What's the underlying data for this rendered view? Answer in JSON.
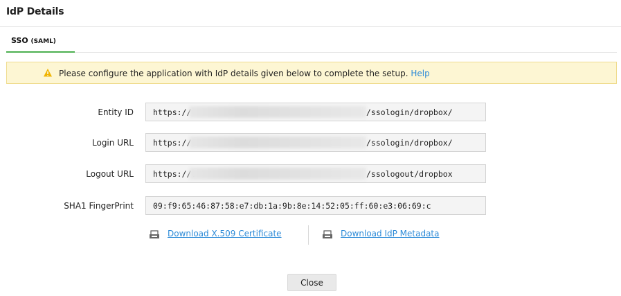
{
  "dialog": {
    "title": "IdP Details"
  },
  "tabs": [
    {
      "label_main": "SSO",
      "label_sub": "(SAML)"
    }
  ],
  "notice": {
    "text": "Please configure the application with IdP details given below to complete the setup.",
    "link": "Help"
  },
  "fields": [
    {
      "label": "Entity ID",
      "prefix": "https://",
      "suffix": "/ssologin/dropbox/"
    },
    {
      "label": "Login URL",
      "prefix": "https://",
      "suffix": "/ssologin/dropbox/"
    },
    {
      "label": "Logout URL",
      "prefix": "https://.",
      "suffix": "/ssologout/dropbox"
    },
    {
      "label": "SHA1 FingerPrint",
      "value": "09:f9:65:46:87:58:e7:db:1a:9b:8e:14:52:05:ff:60:e3:06:69:c"
    }
  ],
  "downloads": {
    "certificate": "Download X.509 Certificate",
    "metadata": "Download IdP Metadata"
  },
  "buttons": {
    "close": "Close"
  },
  "colors": {
    "accent": "#4caf50",
    "link": "#2d8bd8",
    "warning": "#f0b400",
    "notice_bg": "#fdf6d3"
  },
  "icons": {
    "warning": "warning-triangle-icon",
    "download": "download-file-icon"
  }
}
